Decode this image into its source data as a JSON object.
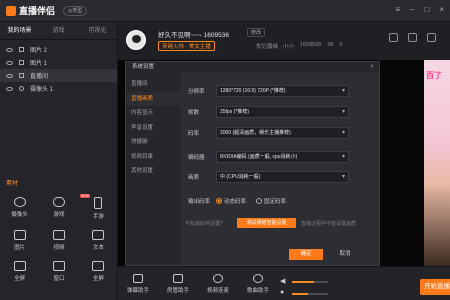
{
  "app": {
    "title": "直播伴侣",
    "badge": "◎类型"
  },
  "left_tabs": [
    "我的场景",
    "游戏",
    "可视化"
  ],
  "scenes": [
    {
      "label": "图片 2"
    },
    {
      "label": "图片 1"
    },
    {
      "label": "直播间"
    },
    {
      "label": "摄像头 1"
    }
  ],
  "materials": {
    "title": "素材",
    "items": [
      {
        "label": "摄像头"
      },
      {
        "label": "游戏"
      },
      {
        "label": "手游",
        "badge": "NEW"
      },
      {
        "label": "图片"
      },
      {
        "label": "视频"
      },
      {
        "label": "文本"
      },
      {
        "label": "全屏"
      },
      {
        "label": "窗口"
      },
      {
        "label": "全屏"
      }
    ]
  },
  "header": {
    "username": "好久不见啊~~~ 1609536",
    "edit": "修改",
    "category": "穿越火线 - 美女主播",
    "meta1": "失忆魔缘 · 小小",
    "meta2": "1609536",
    "meta3": "36",
    "meta4": "0"
  },
  "dialog": {
    "title": "系统设置",
    "close": "×",
    "sidebar": [
      "直播间",
      "直播画质",
      "内容显示",
      "声音设置",
      "快捷键",
      "视频目录",
      "其他设置"
    ],
    "active_index": 1,
    "fields": [
      {
        "label": "分辨率",
        "value": "1280*720 (16:9) 720P (*推荐)"
      },
      {
        "label": "帧数",
        "value": "25fps (*推荐)"
      },
      {
        "label": "码率",
        "value": "2000 (超清画质，娱乐主播推荐)"
      },
      {
        "label": "编码器",
        "value": "NVIDIA编码 (画质一般, cpu消耗小)"
      },
      {
        "label": "画质",
        "value": "中 (CPU消耗一般)"
      }
    ],
    "bitrate_mode": {
      "label": "输出码率",
      "option_dynamic": "动态码率",
      "option_fixed": "固定码率"
    },
    "hint": "不知道如何设置？",
    "smart_button": "测试网络智能设置",
    "hint2": "直播过程中不能设置画质",
    "ok": "确定",
    "cancel": "取消"
  },
  "bottom_tools": [
    "弹幕助手",
    "房管助手",
    "视频连麦",
    "歌曲助手"
  ],
  "volume": {
    "speaker": 0.6,
    "mic": 0.45
  },
  "start_button": "开始直播",
  "photo_text": "百了"
}
